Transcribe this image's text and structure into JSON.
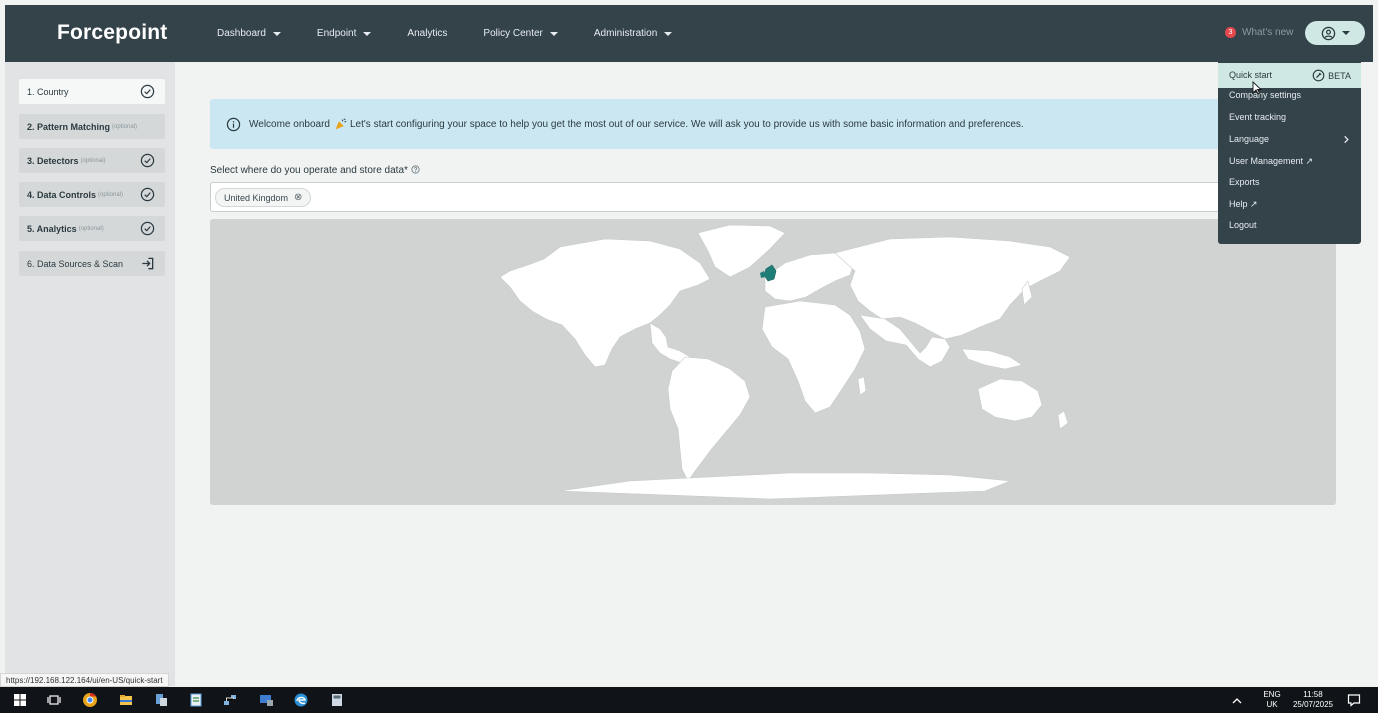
{
  "header": {
    "logo": "Forcepoint",
    "nav": [
      {
        "label": "Dashboard",
        "has_caret": true
      },
      {
        "label": "Endpoint",
        "has_caret": true
      },
      {
        "label": "Analytics",
        "has_caret": false
      },
      {
        "label": "Policy Center",
        "has_caret": true
      },
      {
        "label": "Administration",
        "has_caret": true
      }
    ],
    "whats_new_count": "3",
    "whats_new_label": "What's new"
  },
  "sidebar": {
    "steps": [
      {
        "label": "1. Country",
        "optional": "",
        "icon": "check-circle-icon"
      },
      {
        "label": "2. Pattern Matching",
        "optional": "(optional)",
        "icon": ""
      },
      {
        "label": "3. Detectors",
        "optional": "(optional)",
        "icon": "check-circle-icon"
      },
      {
        "label": "4. Data Controls",
        "optional": "(optional)",
        "icon": "check-circle-icon"
      },
      {
        "label": "5. Analytics",
        "optional": "(optional)",
        "icon": "check-circle-icon"
      },
      {
        "label": "6. Data Sources & Scan",
        "optional": "",
        "icon": "exit-arrow-icon"
      }
    ]
  },
  "main": {
    "banner_text_a": "Welcome onboard",
    "banner_text_b": "Let's start configuring your space to help you get the most out of our service. We will ask you to provide us with some basic information and preferences.",
    "select_label": "Select where do you operate and store data*",
    "selected_country": "United Kingdom"
  },
  "user_menu": {
    "items": [
      {
        "label": "Quick start",
        "active": true
      },
      {
        "label": "Company settings"
      },
      {
        "label": "Event tracking"
      },
      {
        "label": "Language"
      },
      {
        "label": "User Management ↗"
      },
      {
        "label": "Exports"
      },
      {
        "label": "Help ↗"
      },
      {
        "label": "Logout"
      }
    ],
    "beta_label": "BETA"
  },
  "status_url": "https://192.168.122.164/ui/en-US/quick-start",
  "taskbar": {
    "lang_top": "ENG",
    "lang_bottom": "UK",
    "time": "11:58",
    "date": "25/07/2025"
  },
  "colors": {
    "header_bg": "#34434a",
    "accent": "#cfe8e4",
    "highlight_country": "#1f7f78"
  }
}
